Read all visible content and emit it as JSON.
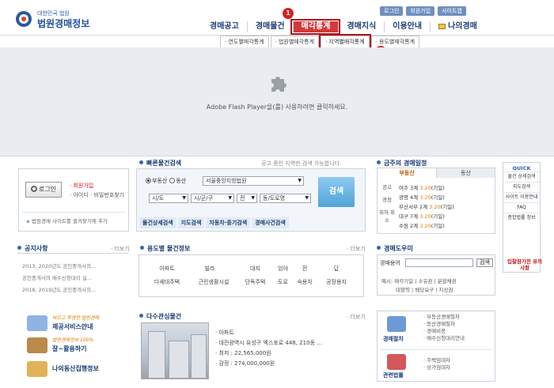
{
  "header": {
    "logo_small": "대한민국 법원",
    "logo_big": "법원경매정보",
    "utility_links": [
      "로그인",
      "회원가입",
      "사이트맵"
    ],
    "nav": [
      {
        "label": "경매공고",
        "active": false
      },
      {
        "label": "경매물건",
        "active": false
      },
      {
        "label": "매각통계",
        "active": true
      },
      {
        "label": "경매지식",
        "active": false
      },
      {
        "label": "이용안내",
        "active": false
      },
      {
        "label": "나의경매",
        "active": false
      }
    ],
    "subnav": [
      {
        "label": "· 연도별매각통계",
        "active": false
      },
      {
        "label": "· 법원별매각통계",
        "active": false
      },
      {
        "label": "· 지역별매각통계",
        "active": true
      },
      {
        "label": "· 용도별매각통계",
        "active": false
      }
    ],
    "badges": [
      "1",
      "2"
    ]
  },
  "flash": {
    "message": "Adobe Flash Player을(를) 사용하려면 클릭하세요."
  },
  "login": {
    "button": "로그인",
    "join": "· 회원가입",
    "find": "· 아이디 · 비밀번호찾기",
    "favorite": "법원경매 사이트를 즐겨찾기에 추가"
  },
  "search": {
    "title": "빠른물건검색",
    "hint": "공고 중인 지역만 검색 가능합니다.",
    "radio_real_estate": "부동산",
    "radio_movable": "동산",
    "court_select": "서울중앙지방법원",
    "city_select": "시/도",
    "district_select": "시/군/구",
    "dong_select": "전",
    "road_select": "동/도로명",
    "search_button": "검색",
    "tabs": [
      "물건상세검색",
      "지도검색",
      "자동차·중기검색",
      "경매사건검색"
    ]
  },
  "schedule": {
    "title": "금주의 경매일정",
    "tabs": [
      "부동산",
      "동산"
    ],
    "side_tabs": [
      "공고",
      "경정",
      "취하 취소"
    ],
    "lines": [
      {
        "text": "여주 3계",
        "date": "3.20",
        "tail": "(기일)"
      },
      {
        "text": "광명 4계",
        "date": "3.20",
        "tail": "(기일)"
      },
      {
        "text": "부산서부 2계",
        "date": "3.20",
        "tail": "(기일)"
      },
      {
        "text": "대구 7계",
        "date": "3.20",
        "tail": "(기일)"
      },
      {
        "text": "수원 2계",
        "date": "3.20",
        "tail": "(기일)"
      }
    ]
  },
  "quick": {
    "title": "QUICK",
    "items": [
      "물건 상세검색",
      "지도검색",
      "사이트 이용안내",
      "FAQ",
      "종합법률 정보"
    ]
  },
  "notice": {
    "title": "공지사항",
    "more": "· 더보기",
    "items": [
      "2013, 2020년도 공인중개사의...",
      "공인중개사의 매수신청대리 실...",
      "2018, 2019년도 공인중개사의..."
    ]
  },
  "usage": {
    "title": "용도별 물건정보",
    "more": "· 더보기",
    "row1": [
      "아파트",
      "빌라",
      "대지",
      "임야",
      "전",
      "답"
    ],
    "row2": [
      "다세대주택",
      "근린생활시설",
      "단독주택",
      "도로",
      "숙용차",
      "공장용지"
    ]
  },
  "helper": {
    "title": "경매도우미",
    "label": "경매용어",
    "button": "검색",
    "examples_line1": "예시: 매각기일 | 소유권 | 분할채권",
    "examples_line2": "대항력 | 배당요구 | 지상권"
  },
  "promo": [
    {
      "small": "바르고 투명한 법원경매",
      "big": "제공서비스안내"
    },
    {
      "small": "법원경매정보 100%",
      "big": "잘~활용하기"
    },
    {
      "small": "",
      "big": "나의동산집행정보"
    }
  ],
  "multi": {
    "title": "다수관심물건",
    "more": "· 더보기",
    "lines": [
      "· 아파트",
      "· 대전광역시 유성구 엑스포로 448, 210동 ...",
      "· 최저 : 22,565,000원",
      "· 감정 : 274,000,000원"
    ]
  },
  "bottom_right": {
    "badge": "입찰참가전 유의사항",
    "groups": [
      {
        "label": "경매절차",
        "items": [
          "· 부동산경매절차",
          "· 동산경매절차",
          "· 경매비용",
          "· 매수신청대리안내"
        ]
      },
      {
        "label": "관련법률",
        "items": [
          "· 주택임대차",
          "· 상가임대차"
        ]
      }
    ]
  },
  "colors": {
    "accent": "#1d3f78",
    "highlight": "#b3131b",
    "flash_bg": "#e9ecf0"
  }
}
